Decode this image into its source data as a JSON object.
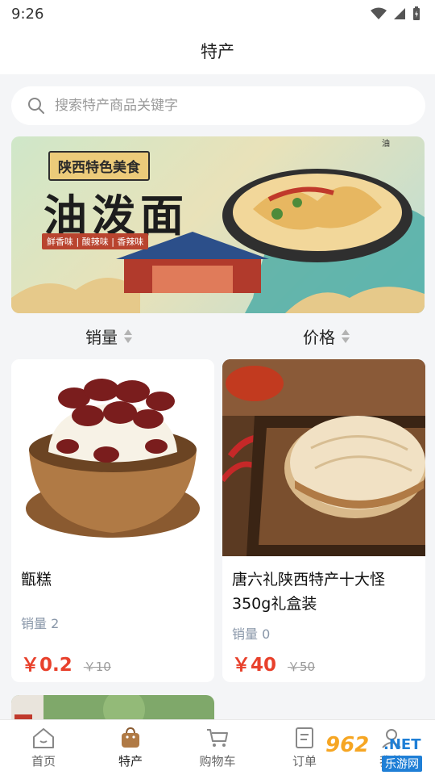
{
  "status": {
    "time": "9:26"
  },
  "header": {
    "title": "特产"
  },
  "search": {
    "placeholder": "搜索特产商品关键字"
  },
  "banner": {
    "tag": "陕西特色美食",
    "title": "油泼面",
    "subtitle": "鲜香味 | 酸辣味 | 香辣味"
  },
  "sort": {
    "sales_label": "销量",
    "price_label": "价格"
  },
  "products": [
    {
      "name": "甑糕",
      "sales": "销量 2",
      "price": "￥0.2",
      "original_price": "￥10"
    },
    {
      "name": "唐六礼陕西特产十大怪350g礼盒装",
      "sales": "销量 0",
      "price": "￥40",
      "original_price": "￥50"
    }
  ],
  "tabs": [
    {
      "label": "首页",
      "icon": "home-icon"
    },
    {
      "label": "特产",
      "icon": "shopping-bag-icon",
      "active": true
    },
    {
      "label": "购物车",
      "icon": "cart-icon"
    },
    {
      "label": "订单",
      "icon": "order-icon"
    },
    {
      "label": "我的",
      "icon": "user-icon"
    }
  ],
  "watermark": {
    "number": "962",
    "suffix": ".NET",
    "sub": "乐游网"
  },
  "colors": {
    "accent": "#e8412c",
    "background": "#f4f5f7",
    "muted": "#8896a8"
  }
}
